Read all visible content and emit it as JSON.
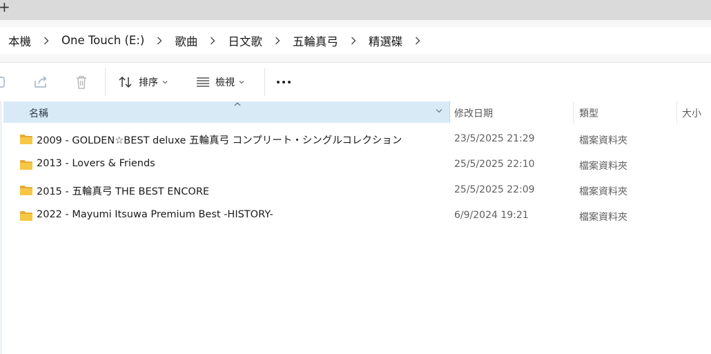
{
  "tab_bar": {
    "new_tab_icon": "plus-icon"
  },
  "breadcrumb": {
    "items": [
      {
        "label": "本機"
      },
      {
        "label": "One Touch (E:)"
      },
      {
        "label": "歌曲"
      },
      {
        "label": "日文歌"
      },
      {
        "label": "五輪真弓"
      },
      {
        "label": "精選碟"
      }
    ],
    "separator_icon": "chevron-right-icon"
  },
  "command_bar": {
    "copy_icon": "copy-icon",
    "share_icon": "share-icon",
    "delete_icon": "trash-icon",
    "sort_label": "排序",
    "view_label": "檢視",
    "more_label": "..."
  },
  "columns": {
    "name": "名稱",
    "date_modified": "修改日期",
    "type": "類型",
    "size": "大小"
  },
  "files": [
    {
      "name": "2009 - GOLDEN☆BEST deluxe 五輪真弓 コンプリート・シングルコレクション",
      "date": "23/5/2025 21:29",
      "type": "檔案資料夾"
    },
    {
      "name": "2013 - Lovers & Friends",
      "date": "25/5/2025 22:10",
      "type": "檔案資料夾"
    },
    {
      "name": "2015 - 五輪真弓 THE BEST ENCORE",
      "date": "25/5/2025 22:09",
      "type": "檔案資料夾"
    },
    {
      "name": "2022 - Mayumi Itsuwa Premium Best -HISTORY-",
      "date": "6/9/2024 19:21",
      "type": "檔案資料夾"
    }
  ],
  "colors": {
    "folder": "#f6c744",
    "selected_column": "#d9eaf7",
    "tab_strip": "#dadada"
  }
}
